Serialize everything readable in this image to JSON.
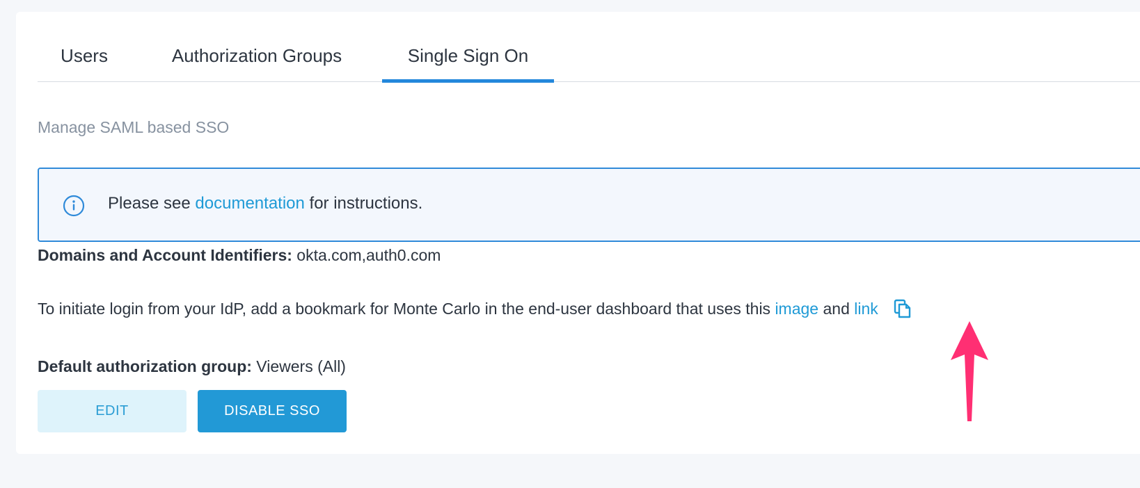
{
  "tabs": [
    {
      "label": "Users",
      "active": false
    },
    {
      "label": "Authorization Groups",
      "active": false
    },
    {
      "label": "Single Sign On",
      "active": true
    }
  ],
  "subtitle": "Manage SAML based SSO",
  "info": {
    "prefix": "Please see ",
    "link": "documentation",
    "suffix": " for instructions."
  },
  "domains": {
    "label": "Domains and Account Identifiers:",
    "value": " okta.com,auth0.com"
  },
  "idp": {
    "text": "To initiate login from your IdP, add a bookmark for Monte Carlo in the end-user dashboard that uses this ",
    "image_link": "image",
    "and": " and ",
    "link": "link"
  },
  "default_group": {
    "label": "Default authorization group:",
    "value": " Viewers (All)"
  },
  "buttons": {
    "edit": "EDIT",
    "disable": "DISABLE SSO"
  },
  "colors": {
    "accent": "#2387db",
    "link": "#1f9ad6",
    "annotation_arrow": "#ff2f73"
  },
  "icons": [
    "info-icon",
    "copy-icon",
    "annotation-arrow"
  ]
}
